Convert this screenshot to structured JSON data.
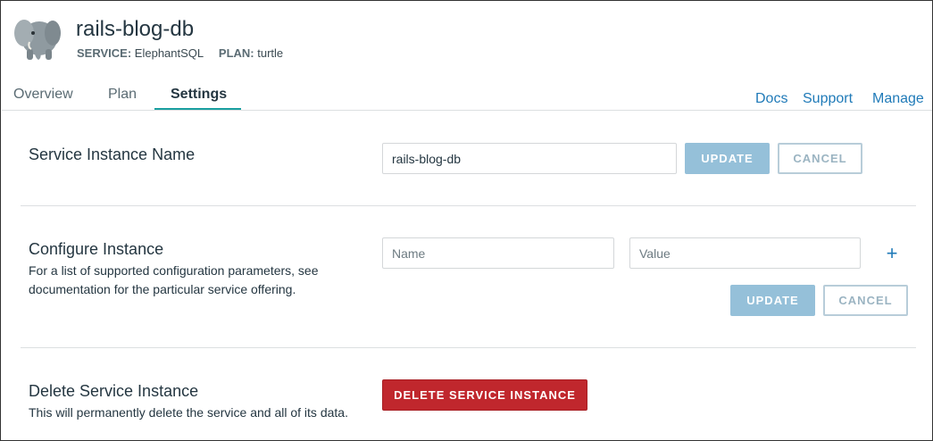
{
  "header": {
    "title": "rails-blog-db",
    "service_key": "SERVICE:",
    "service_value": "ElephantSQL",
    "plan_key": "PLAN:",
    "plan_value": "turtle",
    "logo_icon": "elephant-logo-icon"
  },
  "tabs": [
    {
      "label": "Overview",
      "active": false
    },
    {
      "label": "Plan",
      "active": false
    },
    {
      "label": "Settings",
      "active": true
    }
  ],
  "links": {
    "docs": "Docs",
    "support": "Support",
    "manage": "Manage"
  },
  "instance_name": {
    "title": "Service Instance Name",
    "value": "rails-blog-db",
    "update_label": "UPDATE",
    "cancel_label": "CANCEL"
  },
  "configure": {
    "title": "Configure Instance",
    "description": "For a list of supported configuration parameters, see documentation for the particular service offering.",
    "name_placeholder": "Name",
    "value_placeholder": "Value",
    "add_icon": "plus-icon",
    "update_label": "UPDATE",
    "cancel_label": "CANCEL"
  },
  "delete": {
    "title": "Delete Service Instance",
    "description": "This will permanently delete the service and all of its data.",
    "button_label": "DELETE SERVICE INSTANCE"
  },
  "colors": {
    "accent": "#1a9fa0",
    "link": "#1f7ab8",
    "primary_disabled": "#95c0d9",
    "danger": "#c0272d"
  }
}
